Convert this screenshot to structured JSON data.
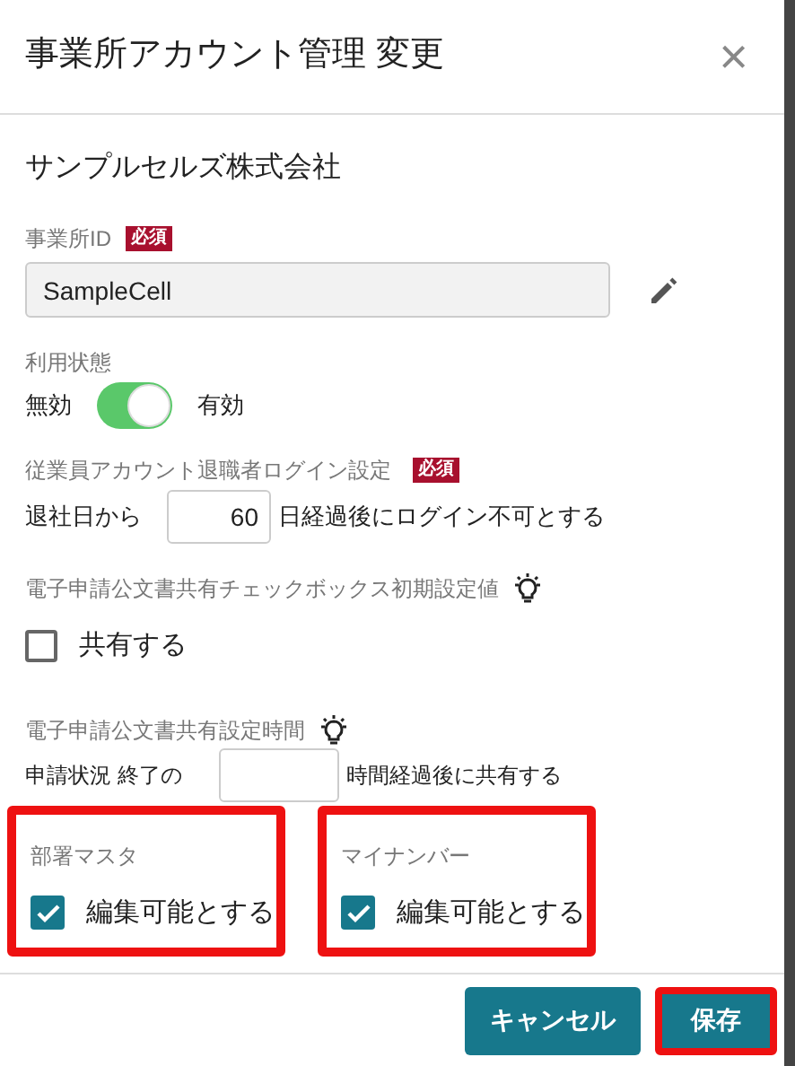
{
  "dialog": {
    "title": "事業所アカウント管理 変更",
    "close": "×"
  },
  "company": "サンプルセルズ株式会社",
  "office_id": {
    "label": "事業所ID",
    "badge": "必須",
    "value": "SampleCell"
  },
  "status": {
    "label": "利用状態",
    "off_label": "無効",
    "on_label": "有効",
    "on": true
  },
  "retiree_login": {
    "label": "従業員アカウント退職者ログイン設定",
    "badge": "必須",
    "prefix": "退社日から",
    "value": "60",
    "suffix": "日経過後にログイン不可とする"
  },
  "share_default": {
    "label": "電子申請公文書共有チェックボックス初期設定値",
    "checkbox": {
      "label": "共有する",
      "checked": false
    }
  },
  "share_time": {
    "label": "電子申請公文書共有設定時間",
    "prefix": "申請状況 終了の",
    "suffix": "時間経過後に共有する"
  },
  "permissions": [
    {
      "label": "部署マスタ",
      "checkbox": {
        "label": "編集可能とする",
        "checked": true
      },
      "highlighted": true
    },
    {
      "label": "マイナンバー",
      "checkbox": {
        "label": "編集可能とする",
        "checked": true
      },
      "highlighted": true
    }
  ],
  "buttons": [
    {
      "label": "キャンセル",
      "highlighted": false
    },
    {
      "label": "保存",
      "highlighted": true
    }
  ]
}
